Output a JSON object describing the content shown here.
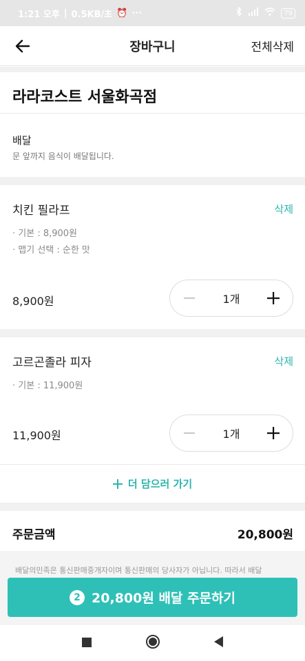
{
  "status_bar": {
    "time": "1:21 오후",
    "network_speed": "0.5KB/초",
    "battery": "79"
  },
  "header": {
    "title": "장바구니",
    "clear_all": "전체삭제"
  },
  "store": {
    "name": "라라코스트 서울화곡점"
  },
  "delivery": {
    "label": "배달",
    "description": "문 앞까지 음식이 배달됩니다."
  },
  "items": [
    {
      "name": "치킨 필라프",
      "delete": "삭제",
      "options": [
        "· 기본 : 8,900원",
        "· 맵기 선택 : 순한 맛"
      ],
      "price": "8,900원",
      "quantity": "1개"
    },
    {
      "name": "고르곤졸라 피자",
      "delete": "삭제",
      "options": [
        "· 기본 : 11,900원"
      ],
      "price": "11,900원",
      "quantity": "1개"
    }
  ],
  "add_more": {
    "label": "더 담으러 가기"
  },
  "summary": {
    "label": "주문금액",
    "total": "20,800원"
  },
  "notice": "배달의민족은 통신판매중개자이며 통신판매의 당사자가 아닙니다. 따라서 배달",
  "order_button": {
    "count": "2",
    "label": "20,800원 배달 주문하기"
  },
  "colors": {
    "accent": "#2ec0b7",
    "delete_text": "#2ab5ac"
  }
}
